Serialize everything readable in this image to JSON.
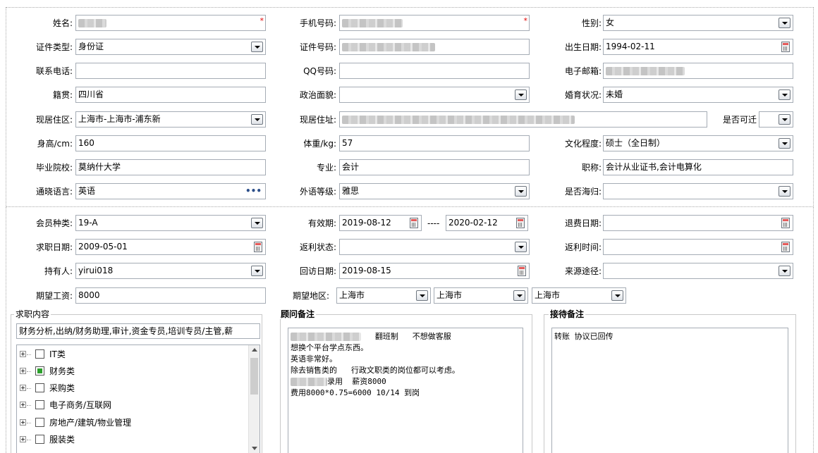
{
  "basic": {
    "name_label": "姓名:",
    "mobile_label": "手机号码:",
    "gender_label": "性别:",
    "gender_value": "女",
    "id_type_label": "证件类型:",
    "id_type_value": "身份证",
    "id_no_label": "证件号码:",
    "birth_label": "出生日期:",
    "birth_value": "1994-02-11",
    "phone_label": "联系电话:",
    "qq_label": "QQ号码:",
    "email_label": "电子邮箱:",
    "native_label": "籍贯:",
    "native_value": "四川省",
    "political_label": "政治面貌:",
    "marital_label": "婚育状况:",
    "marital_value": "未婚",
    "area_label": "现居住区:",
    "area_value": "上海市-上海市-浦东新",
    "address_label": "现居住址:",
    "relocate_label": "是否可迁",
    "height_label": "身高/cm:",
    "height_value": "160",
    "weight_label": "体重/kg:",
    "weight_value": "57",
    "education_label": "文化程度:",
    "education_value": "硕士（全日制）",
    "school_label": "毕业院校:",
    "school_value": "莫纳什大学",
    "major_label": "专业:",
    "major_value": "会计",
    "title_label": "职称:",
    "title_value": "会计从业证书,会计电算化",
    "language_label": "通晓语言:",
    "language_value": "英语",
    "language_more": "•••",
    "foreign_level_label": "外语等级:",
    "foreign_level_value": "雅思",
    "returnee_label": "是否海归:",
    "required_mark": "*"
  },
  "member": {
    "type_label": "会员种类:",
    "type_value": "19-A",
    "valid_label": "有效期:",
    "valid_from": "2019-08-12",
    "valid_sep": "----",
    "valid_to": "2020-02-12",
    "refund_date_label": "退费日期:",
    "job_date_label": "求职日期:",
    "job_date_value": "2009-05-01",
    "rebate_status_label": "返利状态:",
    "rebate_time_label": "返利时间:",
    "holder_label": "持有人:",
    "holder_value": "yirui018",
    "visit_date_label": "回访日期:",
    "visit_date_value": "2019-08-15",
    "source_label": "来源途径:",
    "salary_label": "期望工资:",
    "salary_value": "8000",
    "region_label": "期望地区:",
    "region_1": "上海市",
    "region_2": "上海市",
    "region_3": "上海市"
  },
  "job_content": {
    "title": "求职内容",
    "summary": "财务分析,出纳/财务助理,审计,资金专员,培训专员/主管,薪",
    "tree_items": [
      {
        "label": "IT类",
        "checked": false
      },
      {
        "label": "财务类",
        "checked": true
      },
      {
        "label": "采购类",
        "checked": false
      },
      {
        "label": "电子商务/互联网",
        "checked": false
      },
      {
        "label": "房地产/建筑/物业管理",
        "checked": false
      },
      {
        "label": "服装类",
        "checked": false
      }
    ]
  },
  "advisor_note": {
    "title": "顾问备注",
    "line1": "翻班制   不想做客服",
    "line2": "想换个平台学点东西。",
    "line3": "英语非常好。",
    "line4": "除去销售类的   行政文职类的岗位都可以考虑。",
    "line5": "录用  薪资8000",
    "line6": "费用8000*0.75=6000 10/14 到岗"
  },
  "reception_note": {
    "title": "接待备注",
    "text": "转账 协议已回传"
  }
}
